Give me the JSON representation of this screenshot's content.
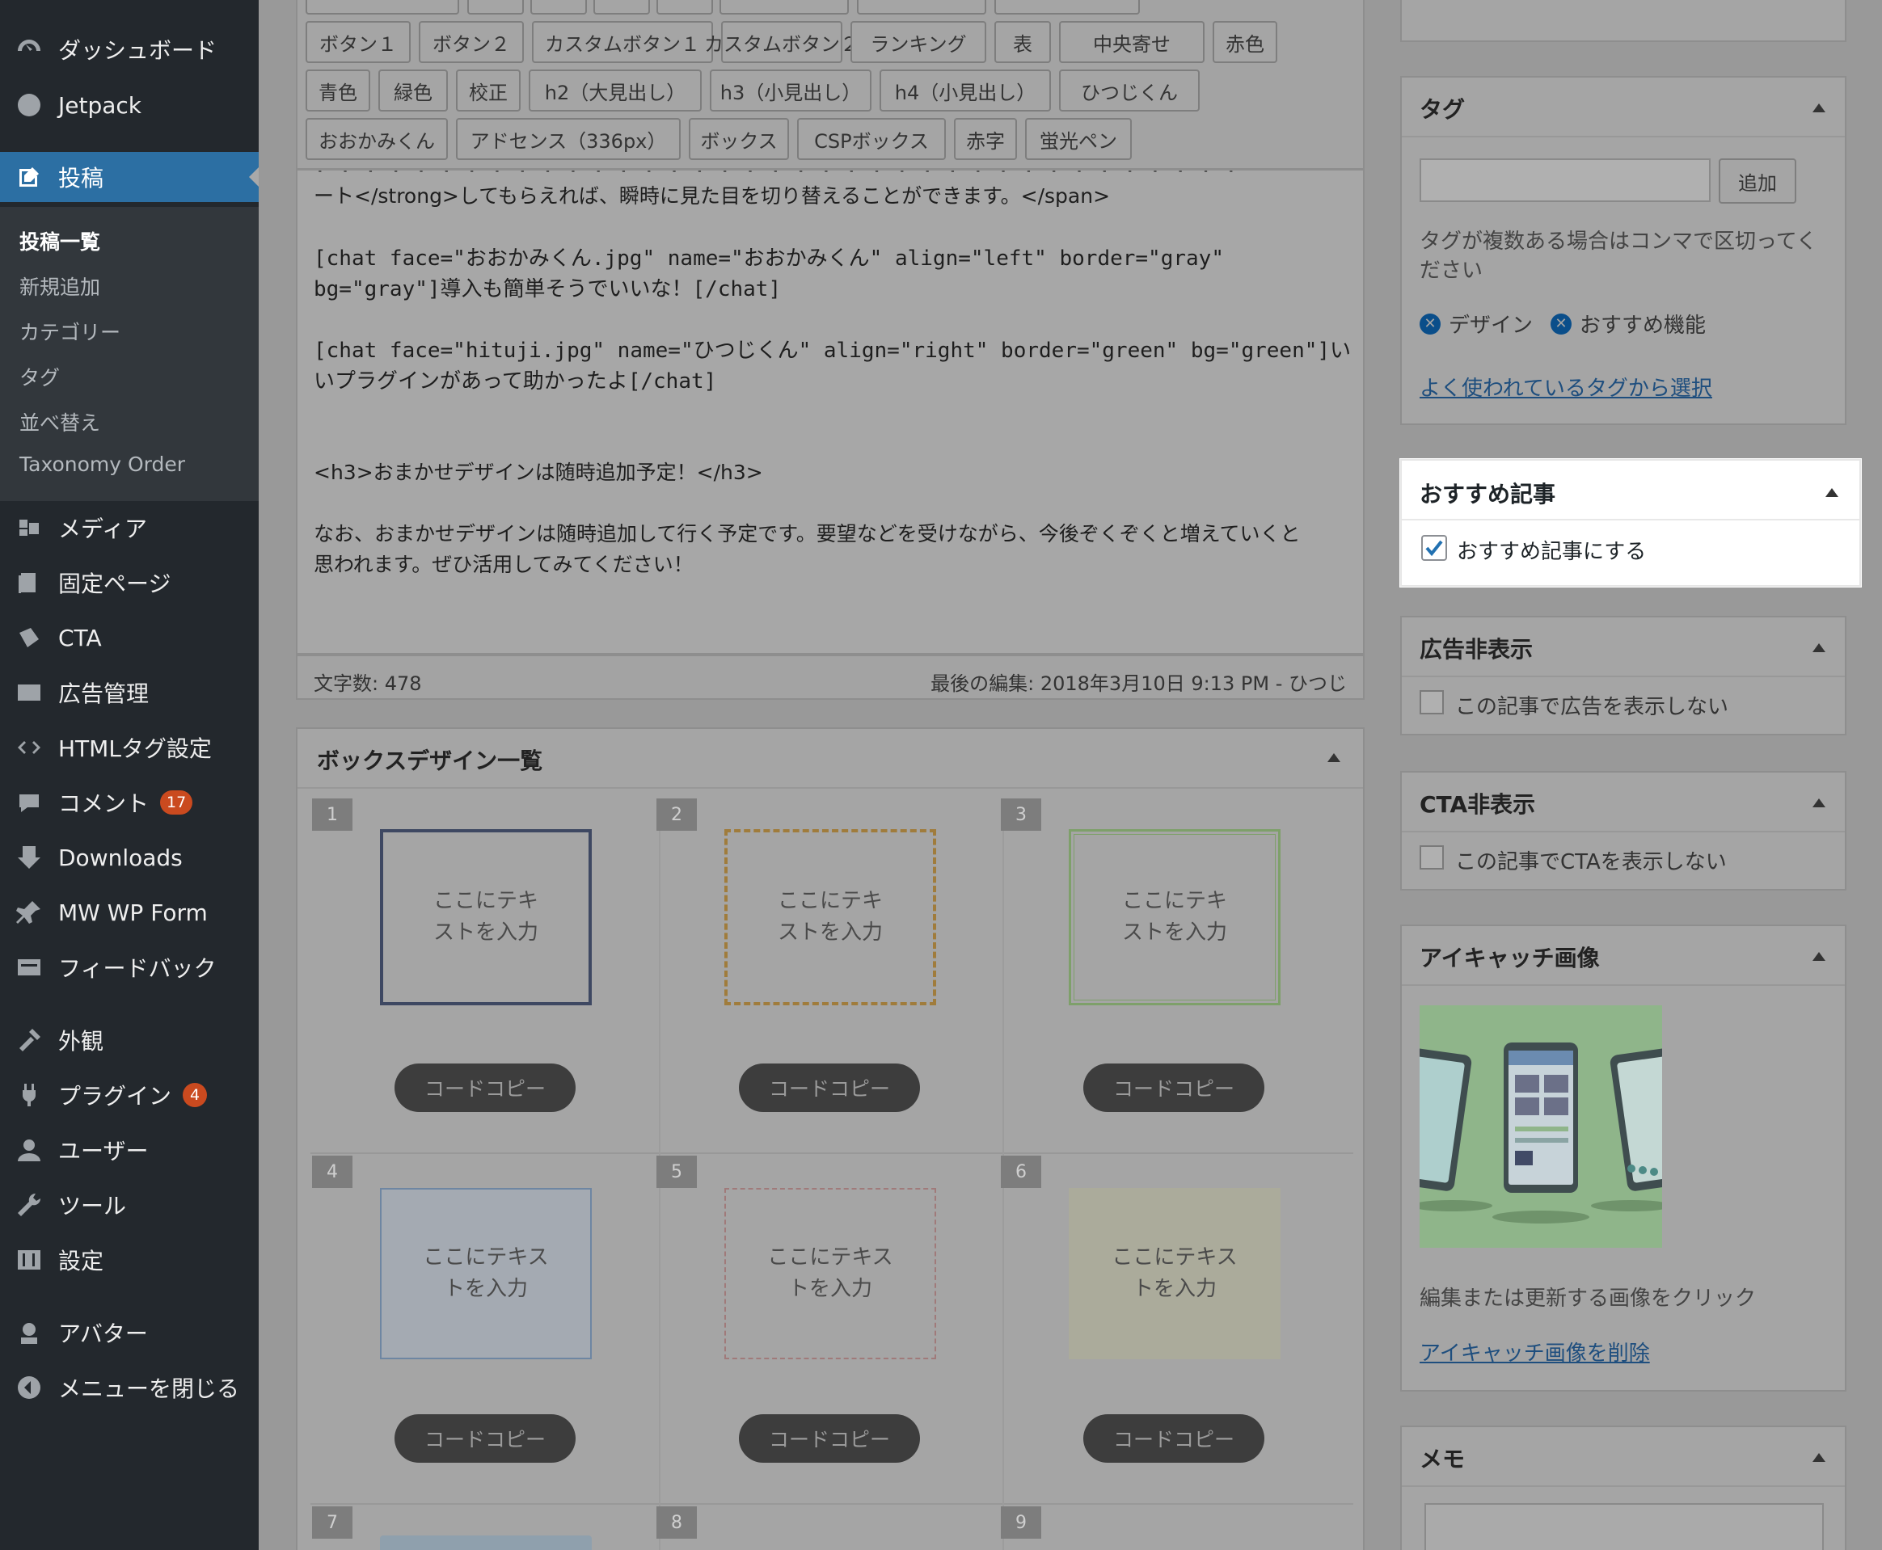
{
  "sidebar": {
    "items": [
      {
        "label": "ダッシュボード",
        "icon": "dashboard-icon"
      },
      {
        "label": "Jetpack",
        "icon": "jetpack-icon"
      },
      {
        "label": "投稿",
        "icon": "posts-icon"
      },
      {
        "label": "メディア",
        "icon": "media-icon"
      },
      {
        "label": "固定ページ",
        "icon": "pages-icon"
      },
      {
        "label": "CTA",
        "icon": "cta-icon"
      },
      {
        "label": "広告管理",
        "icon": "ad-management-icon"
      },
      {
        "label": "HTMLタグ設定",
        "icon": "code-icon"
      },
      {
        "label": "コメント",
        "icon": "comments-icon",
        "badge": "17"
      },
      {
        "label": "Downloads",
        "icon": "download-icon"
      },
      {
        "label": "MW WP Form",
        "icon": "pin-icon"
      },
      {
        "label": "フィードバック",
        "icon": "feedback-icon"
      },
      {
        "label": "外観",
        "icon": "appearance-icon"
      },
      {
        "label": "プラグイン",
        "icon": "plugins-icon",
        "badge": "4"
      },
      {
        "label": "ユーザー",
        "icon": "users-icon"
      },
      {
        "label": "ツール",
        "icon": "tools-icon"
      },
      {
        "label": "設定",
        "icon": "settings-icon"
      },
      {
        "label": "アバター",
        "icon": "avatar-icon"
      },
      {
        "label": "メニューを閉じる",
        "icon": "collapse-icon"
      }
    ],
    "submenu": [
      "投稿一覧",
      "新規追加",
      "カテゴリー",
      "タグ",
      "並べ替え",
      "Taxonomy Order"
    ]
  },
  "toolbar": {
    "row1": [
      "ボタン１",
      "ボタン２",
      "カスタムボタン１",
      "カスタムボタン２",
      "ランキング",
      "表",
      "中央寄せ",
      "赤色"
    ],
    "row2": [
      "青色",
      "緑色",
      "校正",
      "h2（大見出し）",
      "h3（小見出し）",
      "h4（小見出し）",
      "ひつじくん"
    ],
    "row3": [
      "おおかみくん",
      "アドセンス（336px）",
      "ボックス",
      "CSPボックス",
      "赤字",
      "蛍光ペン"
    ]
  },
  "editor": {
    "lines": [
      "ート</strong>してもらえれば、瞬時に見た目を切り替えることができます。</span>",
      "[chat face=\"おおかみくん.jpg\" name=\"おおかみくん\" align=\"left\" border=\"gray\"",
      "bg=\"gray\"]導入も簡単そうでいいな！[/chat]",
      "[chat face=\"hituji.jpg\" name=\"ひつじくん\" align=\"right\" border=\"green\" bg=\"green\"]い",
      "いプラグインがあって助かったよ[/chat]",
      "<h3>おまかせデザインは随時追加予定！</h3>",
      "なお、おまかせデザインは随時追加して行く予定です。要望などを受けながら、今後ぞくぞくと増えていくと",
      "思われます。ぜひ活用してみてください！"
    ],
    "word_count": "文字数: 478",
    "last_edit": "最後の編集: 2018年3月10日 9:13 PM - ひつじ"
  },
  "box_panel": {
    "title": "ボックスデザイン一覧",
    "copy_label": "コードコピー",
    "cells": [
      {
        "num": "1",
        "text": "ここにテキ\nストを入力"
      },
      {
        "num": "2",
        "text": "ここにテキ\nストを入力"
      },
      {
        "num": "3",
        "text": "ここにテキ\nストを入力"
      },
      {
        "num": "4",
        "text": "ここにテキス\nトを入力"
      },
      {
        "num": "5",
        "text": "ここにテキス\nトを入力"
      },
      {
        "num": "6",
        "text": "ここにテキス\nトを入力"
      }
    ],
    "next_nums": [
      "7",
      "8",
      "9"
    ]
  },
  "tags_box": {
    "title": "タグ",
    "input_value": "",
    "add_label": "追加",
    "help": [
      "タグが複数ある場合はコンマで区切ってく",
      "ださい"
    ],
    "tags": [
      "デザイン",
      "おすすめ機能"
    ],
    "choose_link": "よく使われているタグから選択"
  },
  "featured_box": {
    "title": "おすすめ記事",
    "checkbox_label": "おすすめ記事にする",
    "checked": true
  },
  "ad_box": {
    "title": "広告非表示",
    "checkbox_label": "この記事で広告を表示しない"
  },
  "cta_box": {
    "title": "CTA非表示",
    "checkbox_label": "この記事でCTAを表示しない"
  },
  "thumb_box": {
    "title": "アイキャッチ画像",
    "help": "編集または更新する画像をクリック",
    "remove_link": "アイキャッチ画像を削除"
  },
  "memo_box": {
    "title": "メモ"
  },
  "colors": {
    "sidebar_bg": "#23282d",
    "current_menu": "#2c6fa3",
    "badge": "#ca4a1f",
    "link": "#1e4e7e",
    "checkbox_check": "#2271b1",
    "thumb_bg": "#8fb58a"
  }
}
